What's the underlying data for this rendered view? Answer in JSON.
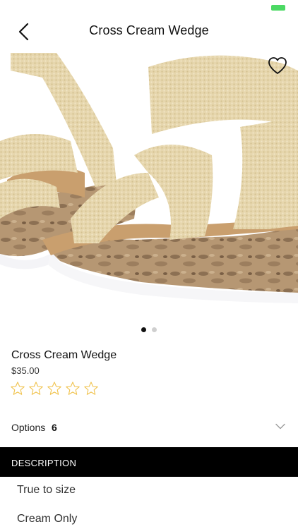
{
  "status_bar": {
    "battery_color": "#4cd964"
  },
  "nav": {
    "title": "Cross Cream Wedge",
    "back_icon": "chevron-left-icon"
  },
  "gallery": {
    "favorite_icon": "heart-outline-icon",
    "page_count": 2,
    "active_page": 1
  },
  "product": {
    "name": "Cross Cream Wedge",
    "price": "$35.00",
    "rating": {
      "value": 0,
      "max": 5,
      "star_color": "#f0c24b"
    }
  },
  "options": {
    "label": "Options",
    "count": "6",
    "icon": "chevron-down-icon"
  },
  "description": {
    "header": "DESCRIPTION",
    "lines": [
      "True to size",
      "Cream Only"
    ]
  },
  "colors": {
    "accent": "#000000",
    "background": "#ffffff"
  }
}
